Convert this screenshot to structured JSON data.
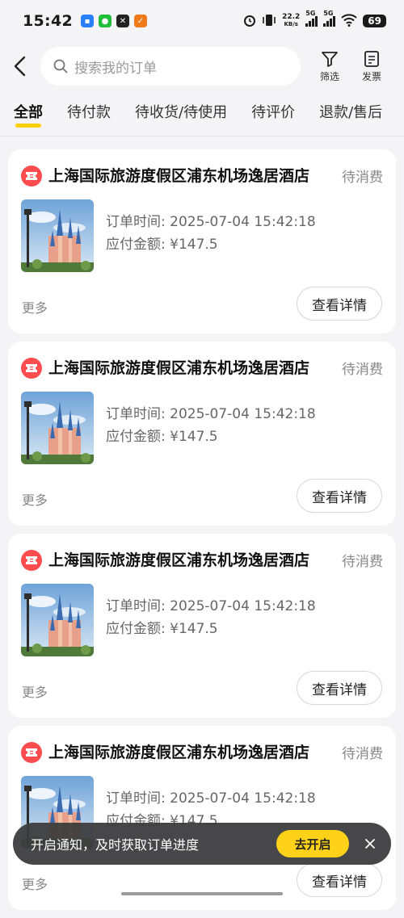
{
  "status_bar": {
    "time": "15:42",
    "net_speed_value": "22.2",
    "net_speed_unit": "KB/s",
    "sig1_tag": "5G",
    "sig2_tag": "5G",
    "battery": "69"
  },
  "header": {
    "search_placeholder": "搜索我的订单",
    "filter_label": "筛选",
    "invoice_label": "发票"
  },
  "tabs": [
    {
      "label": "全部"
    },
    {
      "label": "待付款"
    },
    {
      "label": "待收货/待使用"
    },
    {
      "label": "待评价"
    },
    {
      "label": "退款/售后"
    }
  ],
  "orders": [
    {
      "title": "上海国际旅游度假区浦东机场逸居酒店",
      "status": "待消费",
      "time_label": "订单时间: ",
      "time": "2025-07-04 15:42:18",
      "amount_label": "应付金额: ",
      "amount": "¥147.5",
      "more": "更多",
      "detail_button": "查看详情"
    },
    {
      "title": "上海国际旅游度假区浦东机场逸居酒店",
      "status": "待消费",
      "time_label": "订单时间: ",
      "time": "2025-07-04 15:42:18",
      "amount_label": "应付金额: ",
      "amount": "¥147.5",
      "more": "更多",
      "detail_button": "查看详情"
    },
    {
      "title": "上海国际旅游度假区浦东机场逸居酒店",
      "status": "待消费",
      "time_label": "订单时间: ",
      "time": "2025-07-04 15:42:18",
      "amount_label": "应付金额: ",
      "amount": "¥147.5",
      "more": "更多",
      "detail_button": "查看详情"
    },
    {
      "title": "上海国际旅游度假区浦东机场逸居酒店",
      "status": "待消费",
      "time_label": "订单时间: ",
      "time": "2025-07-04 15:42:18",
      "amount_label": "应付金额: ",
      "amount": "¥147.5",
      "more": "更多",
      "detail_button": "查看详情"
    }
  ],
  "notification": {
    "text": "开启通知，及时获取订单进度",
    "button": "去开启"
  },
  "colors": {
    "accent": "#ffd000",
    "ticket_icon": "#ff4d4f",
    "background": "#f4f4f6"
  }
}
